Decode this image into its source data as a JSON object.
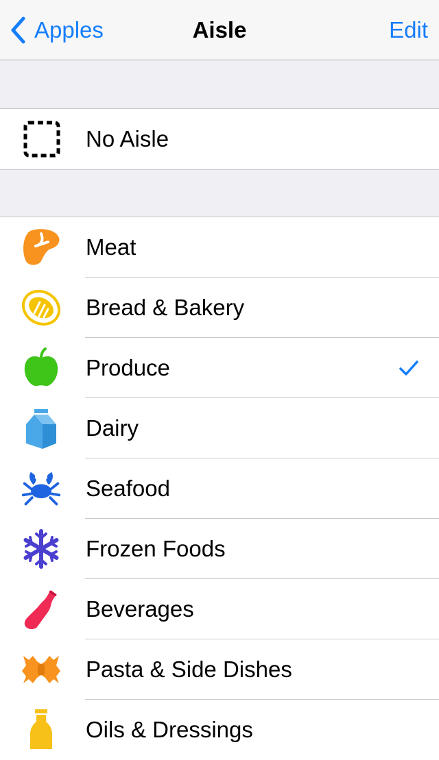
{
  "navbar": {
    "back_label": "Apples",
    "title": "Aisle",
    "edit_label": "Edit"
  },
  "no_aisle": {
    "label": "No Aisle",
    "icon": "dashed-square-icon"
  },
  "aisles": [
    {
      "label": "Meat",
      "icon": "steak-icon",
      "color": "#f7931e",
      "selected": false
    },
    {
      "label": "Bread & Bakery",
      "icon": "bread-icon",
      "color": "#f5c400",
      "selected": false
    },
    {
      "label": "Produce",
      "icon": "apple-icon",
      "color": "#3fc419",
      "selected": true
    },
    {
      "label": "Dairy",
      "icon": "milk-carton-icon",
      "color": "#4ba8e8",
      "selected": false
    },
    {
      "label": "Seafood",
      "icon": "crab-icon",
      "color": "#1e63e0",
      "selected": false
    },
    {
      "label": "Frozen Foods",
      "icon": "snowflake-icon",
      "color": "#4a3fcf",
      "selected": false
    },
    {
      "label": "Beverages",
      "icon": "bottle-icon",
      "color": "#ef2a55",
      "selected": false
    },
    {
      "label": "Pasta & Side Dishes",
      "icon": "pasta-icon",
      "color": "#f7931e",
      "selected": false
    },
    {
      "label": "Oils & Dressings",
      "icon": "oil-bottle-icon",
      "color": "#f7c11a",
      "selected": false
    }
  ],
  "accent_color": "#157efb"
}
